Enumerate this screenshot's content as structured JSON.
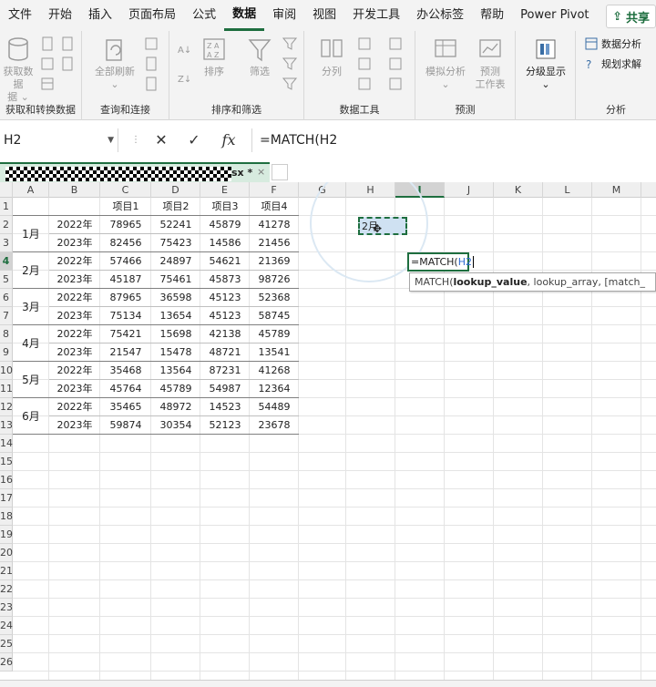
{
  "menu": {
    "items": [
      "文件",
      "开始",
      "插入",
      "页面布局",
      "公式",
      "数据",
      "审阅",
      "视图",
      "开发工具",
      "办公标签",
      "帮助",
      "Power Pivot"
    ],
    "active": "数据",
    "share_label": "共享"
  },
  "ribbon": {
    "get_data_label": "获取数据",
    "get_data_sub": "据 ⌄",
    "refresh_all_label": "全部刷新",
    "sort_label": "排序",
    "filter_label": "筛选",
    "split_label": "分列",
    "whatif_label": "模拟分析",
    "forecast_label": "预测",
    "forecast_sub": "工作表",
    "outline_label": "分级显示",
    "data_analysis_label": "数据分析",
    "solver_label": "规划求解",
    "groups": {
      "get_transform": "获取和转换数据",
      "queries": "查询和连接",
      "sort_filter": "排序和筛选",
      "data_tools": "数据工具",
      "forecast": "预测",
      "analysis": "分析"
    }
  },
  "formula_bar": {
    "name_box": "H2",
    "cancel_icon": "close-icon",
    "enter_icon": "check-icon",
    "fx_label": "fx",
    "formula": "=MATCH(H2"
  },
  "workbook_tab": {
    "name": "sx *",
    "close": "×"
  },
  "columns": [
    "A",
    "B",
    "C",
    "D",
    "E",
    "F",
    "G",
    "H",
    "I",
    "J",
    "K",
    "L",
    "M"
  ],
  "rows": [
    "1",
    "2",
    "3",
    "4",
    "5",
    "6",
    "7",
    "8",
    "9",
    "10",
    "11",
    "12",
    "13",
    "14",
    "15",
    "16",
    "17",
    "18",
    "19",
    "20",
    "21",
    "22",
    "23",
    "24",
    "25",
    "26"
  ],
  "table": {
    "headers": [
      "项目1",
      "项目2",
      "项目3",
      "项目4"
    ],
    "months": [
      "1月",
      "2月",
      "3月",
      "4月",
      "5月",
      "6月"
    ],
    "rows": [
      {
        "year": "2022年",
        "values": [
          "78965",
          "52241",
          "45879",
          "41278"
        ]
      },
      {
        "year": "2023年",
        "values": [
          "82456",
          "75423",
          "14586",
          "21456"
        ]
      },
      {
        "year": "2022年",
        "values": [
          "57466",
          "24897",
          "54621",
          "21369"
        ]
      },
      {
        "year": "2023年",
        "values": [
          "45187",
          "75461",
          "45873",
          "98726"
        ]
      },
      {
        "year": "2022年",
        "values": [
          "87965",
          "36598",
          "45123",
          "52368"
        ]
      },
      {
        "year": "2023年",
        "values": [
          "75134",
          "13654",
          "45123",
          "58745"
        ]
      },
      {
        "year": "2022年",
        "values": [
          "75421",
          "15698",
          "42138",
          "45789"
        ]
      },
      {
        "year": "2023年",
        "values": [
          "21547",
          "15478",
          "48721",
          "13541"
        ]
      },
      {
        "year": "2022年",
        "values": [
          "35468",
          "13564",
          "87231",
          "41268"
        ]
      },
      {
        "year": "2023年",
        "values": [
          "45764",
          "45789",
          "54987",
          "12364"
        ]
      },
      {
        "year": "2022年",
        "values": [
          "35465",
          "48972",
          "14523",
          "54489"
        ]
      },
      {
        "year": "2023年",
        "values": [
          "59874",
          "30354",
          "52123",
          "23678"
        ]
      }
    ]
  },
  "h2_value": "2月",
  "edit_cell": {
    "prefix": "=MATCH(",
    "ref": "H2"
  },
  "tooltip": {
    "fn": "MATCH(",
    "arg1": "lookup_value",
    "rest": ", lookup_array, [match_"
  },
  "colors": {
    "accent": "#1e6e3f",
    "selection": "#cfe1f2"
  }
}
